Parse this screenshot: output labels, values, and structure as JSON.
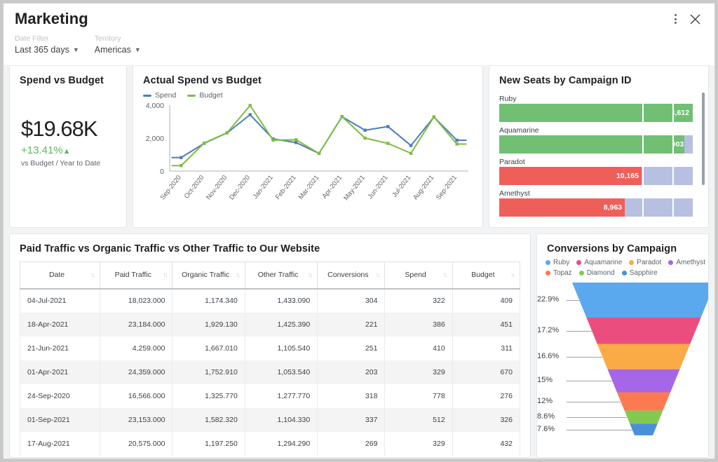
{
  "header": {
    "title": "Marketing",
    "menu_icon": "kebab-menu-icon",
    "close_icon": "close-icon"
  },
  "filters": [
    {
      "label": "Date Filter",
      "value": "Last 365 days"
    },
    {
      "label": "Territory",
      "value": "Americas"
    }
  ],
  "kpi": {
    "title": "Spend vs Budget",
    "value": "$19.68K",
    "delta": "+13.41%",
    "delta_arrow": "▲",
    "delta_color": "#5cb85c",
    "subtitle": "vs Budget / Year to Date"
  },
  "line_card": {
    "title": "Actual Spend vs Budget"
  },
  "bar_card": {
    "title": "New Seats by Campaign ID",
    "rest_color": "#b7c0e0",
    "thresholds": [
      {
        "value": 10213,
        "label": "10,213",
        "color": "#ef5350"
      },
      {
        "value": 12252,
        "label": "12,252",
        "color": "#fbc02d"
      },
      {
        "value": 13612,
        "label": "13,612",
        "color": "#66bb6a"
      }
    ],
    "bars": [
      {
        "label": "Ruby",
        "value": 13612,
        "value_label": "13,612",
        "color": "#71bf73"
      },
      {
        "label": "Aquamarine",
        "value": 13003,
        "value_label": "13,003",
        "color": "#71bf73"
      },
      {
        "label": "Paradot",
        "value": 10165,
        "value_label": "10,165",
        "color": "#ef5f5a"
      },
      {
        "label": "Amethyst",
        "value": 8963,
        "value_label": "8,963",
        "color": "#ef5f5a"
      }
    ]
  },
  "table_card": {
    "title": "Paid Traffic vs Organic Traffic vs Other Traffic to Our Website",
    "columns": [
      "Date",
      "Paid Traffic",
      "Organic Traffic",
      "Other Traffic",
      "Conversions",
      "Spend",
      "Budget"
    ],
    "rows": [
      [
        "04-Jul-2021",
        "18,023.000",
        "1,174.340",
        "1,433.090",
        "304",
        "322",
        "409"
      ],
      [
        "18-Apr-2021",
        "23,184.000",
        "1,929.130",
        "1,425.390",
        "221",
        "386",
        "451"
      ],
      [
        "21-Jun-2021",
        "4,259.000",
        "1,667.010",
        "1,105.540",
        "251",
        "410",
        "311"
      ],
      [
        "01-Apr-2021",
        "24,359.000",
        "1,752.910",
        "1,053.540",
        "203",
        "329",
        "670"
      ],
      [
        "24-Sep-2020",
        "16,566.000",
        "1,325.770",
        "1,277.770",
        "318",
        "778",
        "276"
      ],
      [
        "01-Sep-2021",
        "23,153.000",
        "1,582.320",
        "1,104.330",
        "337",
        "512",
        "326"
      ],
      [
        "17-Aug-2021",
        "20,575.000",
        "1,197.250",
        "1,294.290",
        "269",
        "329",
        "432"
      ]
    ]
  },
  "funnel_card": {
    "title": "Conversions by Campaign",
    "legend": [
      {
        "label": "Ruby",
        "color": "#5aa9ee"
      },
      {
        "label": "Aquamarine",
        "color": "#ec4d7f"
      },
      {
        "label": "Paradot",
        "color": "#fbab45"
      },
      {
        "label": "Amethyst",
        "color": "#a567e8"
      },
      {
        "label": "Topaz",
        "color": "#fb7a52"
      },
      {
        "label": "Diamond",
        "color": "#84c94f"
      },
      {
        "label": "Sapphire",
        "color": "#4a90d9"
      }
    ]
  },
  "chart_data": [
    {
      "type": "line",
      "title": "Actual Spend vs Budget",
      "xlabel": "",
      "ylabel": "",
      "ylim": [
        0,
        4000
      ],
      "yticks": [
        0,
        2000,
        4000
      ],
      "ytick_labels": [
        "0",
        "2,000",
        "4,000"
      ],
      "grid": false,
      "legend_position": "top-left",
      "categories": [
        "Sep-2020",
        "Oct-2020",
        "Nov-2020",
        "Dec-2020",
        "Jan-2021",
        "Feb-2021",
        "Mar-2021",
        "Apr-2021",
        "May-2021",
        "Jun-2021",
        "Jul-2021",
        "Aug-2021",
        "Sep-2021"
      ],
      "series": [
        {
          "name": "Spend",
          "color": "#4a7ebb",
          "values": [
            820,
            1680,
            2320,
            3420,
            1950,
            1730,
            1070,
            3300,
            2480,
            2700,
            1550,
            3280,
            1870
          ]
        },
        {
          "name": "Budget",
          "color": "#7dbd42",
          "values": [
            330,
            1700,
            2330,
            3980,
            1880,
            1900,
            1070,
            3310,
            2000,
            1680,
            1080,
            3290,
            1640
          ]
        }
      ]
    },
    {
      "type": "bar",
      "subtype": "bullet",
      "title": "New Seats by Campaign ID",
      "categories": [
        "Ruby",
        "Aquamarine",
        "Paradot",
        "Amethyst"
      ],
      "values": [
        13612,
        13003,
        10165,
        8963
      ],
      "xlim": [
        0,
        13612
      ],
      "thresholds": [
        10213,
        12252,
        13612
      ]
    },
    {
      "type": "funnel",
      "title": "Conversions by Campaign",
      "categories": [
        "Ruby",
        "Aquamarine",
        "Paradot",
        "Amethyst",
        "Topaz",
        "Diamond",
        "Sapphire"
      ],
      "values": [
        22.9,
        17.2,
        16.6,
        15,
        12,
        8.6,
        7.6
      ],
      "value_labels": [
        "22.9%",
        "17.2%",
        "16.6%",
        "15%",
        "12%",
        "8.6%",
        "7.6%"
      ],
      "colors": [
        "#5aa9ee",
        "#ec4d7f",
        "#fbab45",
        "#a567e8",
        "#fb7a52",
        "#84c94f",
        "#4a90d9"
      ]
    },
    {
      "type": "table",
      "title": "Paid Traffic vs Organic Traffic vs Other Traffic to Our Website",
      "columns": [
        "Date",
        "Paid Traffic",
        "Organic Traffic",
        "Other Traffic",
        "Conversions",
        "Spend",
        "Budget"
      ],
      "rows": [
        [
          "04-Jul-2021",
          "18,023.000",
          "1,174.340",
          "1,433.090",
          "304",
          "322",
          "409"
        ],
        [
          "18-Apr-2021",
          "23,184.000",
          "1,929.130",
          "1,425.390",
          "221",
          "386",
          "451"
        ],
        [
          "21-Jun-2021",
          "4,259.000",
          "1,667.010",
          "1,105.540",
          "251",
          "410",
          "311"
        ],
        [
          "01-Apr-2021",
          "24,359.000",
          "1,752.910",
          "1,053.540",
          "203",
          "329",
          "670"
        ],
        [
          "24-Sep-2020",
          "16,566.000",
          "1,325.770",
          "1,277.770",
          "318",
          "778",
          "276"
        ],
        [
          "01-Sep-2021",
          "23,153.000",
          "1,582.320",
          "1,104.330",
          "337",
          "512",
          "326"
        ],
        [
          "17-Aug-2021",
          "20,575.000",
          "1,197.250",
          "1,294.290",
          "269",
          "329",
          "432"
        ]
      ]
    }
  ]
}
